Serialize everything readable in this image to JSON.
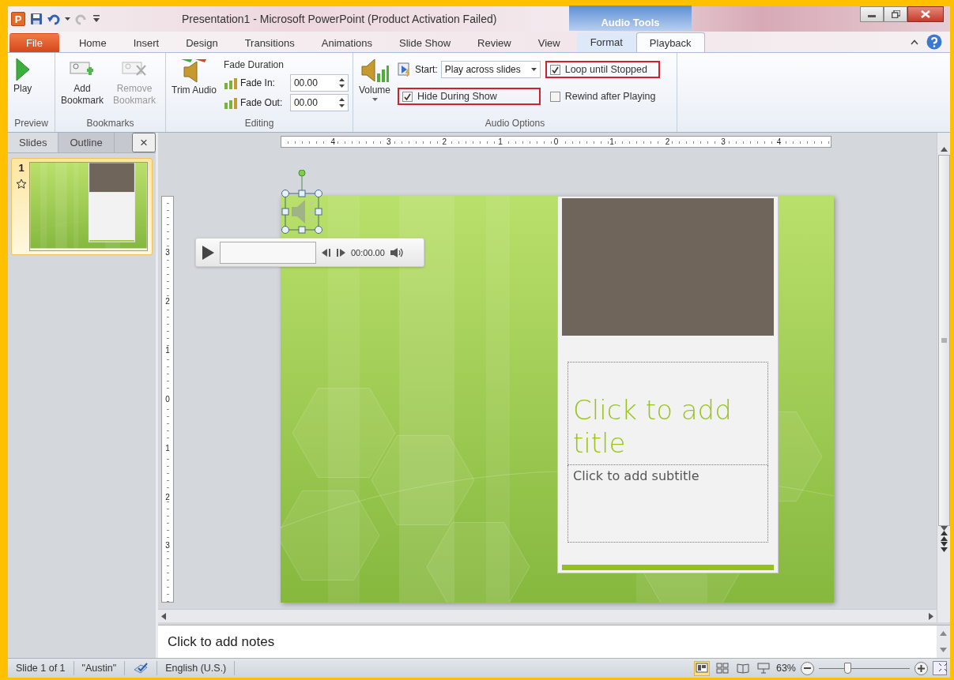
{
  "window": {
    "logo": "P",
    "title": "Presentation1  -  Microsoft PowerPoint (Product Activation Failed)",
    "contextual_group": "Audio Tools"
  },
  "tabs": [
    {
      "label": "File",
      "kind": "file",
      "selected": false
    },
    {
      "label": "Home",
      "kind": "main",
      "selected": false
    },
    {
      "label": "Insert",
      "kind": "main",
      "selected": false
    },
    {
      "label": "Design",
      "kind": "main",
      "selected": false
    },
    {
      "label": "Transitions",
      "kind": "main",
      "selected": false
    },
    {
      "label": "Animations",
      "kind": "main",
      "selected": false
    },
    {
      "label": "Slide Show",
      "kind": "main",
      "selected": false
    },
    {
      "label": "Review",
      "kind": "main",
      "selected": false
    },
    {
      "label": "View",
      "kind": "main",
      "selected": false
    },
    {
      "label": "Format",
      "kind": "contextual",
      "selected": false
    },
    {
      "label": "Playback",
      "kind": "contextual",
      "selected": true
    }
  ],
  "ribbon": {
    "preview": {
      "label": "Preview",
      "play": "Play"
    },
    "bookmarks": {
      "label": "Bookmarks",
      "buttons": [
        {
          "label": "Add Bookmark",
          "disabled": false
        },
        {
          "label": "Remove Bookmark",
          "disabled": true
        }
      ]
    },
    "editing": {
      "label": "Editing",
      "trim": "Trim Audio",
      "fade_title": "Fade Duration",
      "fields": [
        {
          "label": "Fade In:",
          "value": "00.00"
        },
        {
          "label": "Fade Out:",
          "value": "00.00"
        }
      ]
    },
    "audio_options": {
      "label": "Audio Options",
      "volume": "Volume",
      "start_label": "Start:",
      "start_value": "Play across slides",
      "options": [
        {
          "label": "Loop until Stopped",
          "checked": true,
          "highlighted": true
        },
        {
          "label": "Hide During Show",
          "checked": true,
          "highlighted": true
        },
        {
          "label": "Rewind after Playing",
          "checked": false,
          "highlighted": false
        }
      ]
    }
  },
  "side_pane": {
    "tabs": [
      {
        "label": "Slides",
        "selected": true
      },
      {
        "label": "Outline",
        "selected": false
      }
    ],
    "close": "×",
    "slides": [
      {
        "number": "1",
        "selected": true
      }
    ]
  },
  "rulers": {
    "horizontal": [
      "4",
      "3",
      "2",
      "1",
      "0",
      "1",
      "2",
      "3",
      "4"
    ],
    "vertical": [
      "3",
      "2",
      "1",
      "0",
      "1",
      "2",
      "3"
    ]
  },
  "audio_player": {
    "time": "00:00.00"
  },
  "slide": {
    "title_placeholder": "Click to add title",
    "subtitle_placeholder": "Click to add subtitle"
  },
  "notes": {
    "placeholder": "Click to add notes"
  },
  "status_bar": {
    "items": [
      "Slide 1 of 1",
      "\"Austin\"",
      "English (U.S.)"
    ],
    "views": [
      {
        "kind": "normal",
        "selected": true
      },
      {
        "kind": "sorter",
        "selected": false
      },
      {
        "kind": "reading",
        "selected": false
      },
      {
        "kind": "show",
        "selected": false
      }
    ],
    "zoom": "63%",
    "zoom_level": {
      "level": 0.31
    }
  }
}
